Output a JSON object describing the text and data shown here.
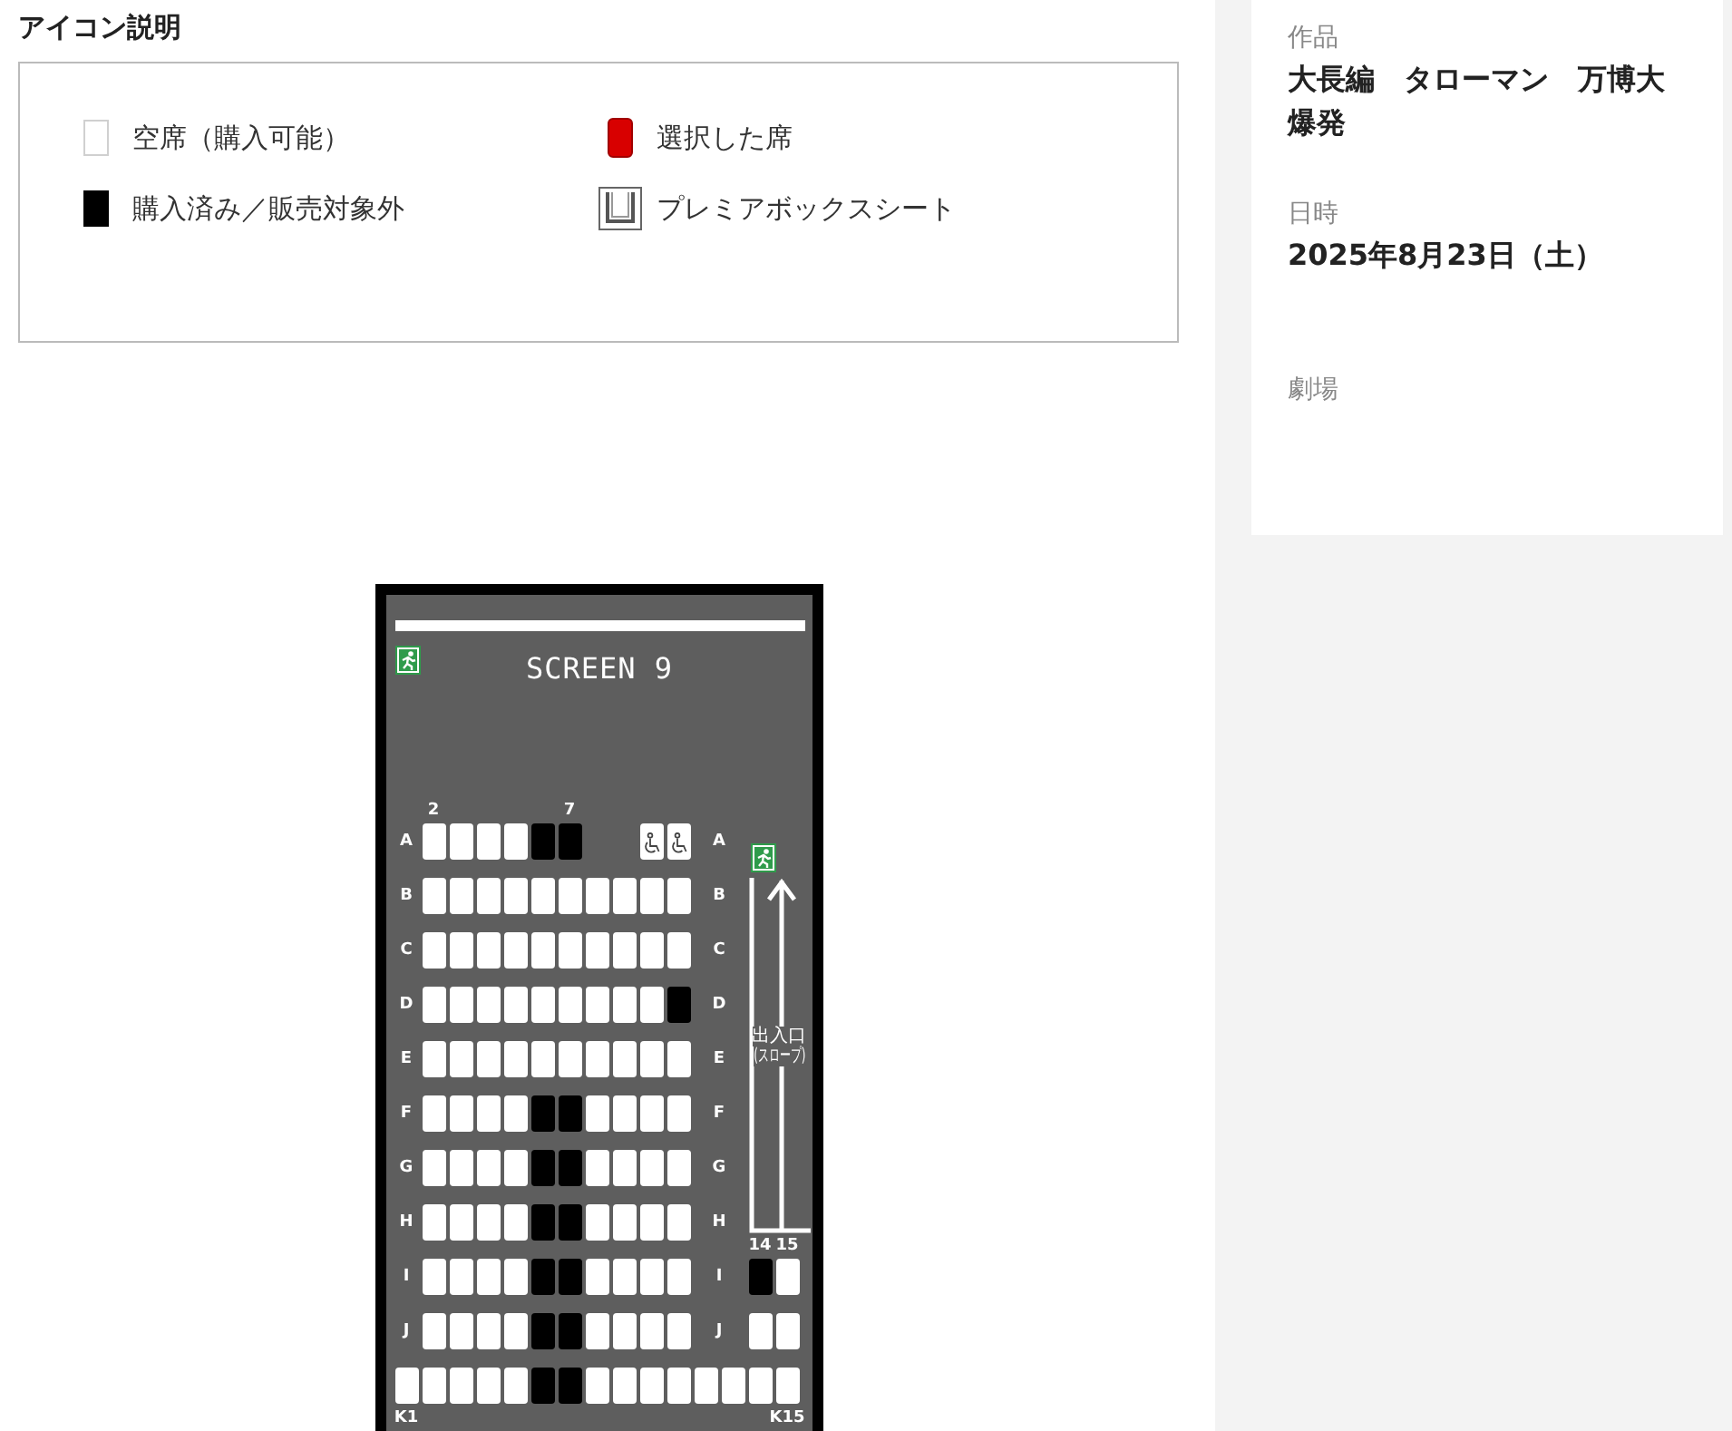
{
  "legend": {
    "title": "アイコン説明",
    "items": [
      {
        "kind": "available",
        "label": "空席（購入可能）"
      },
      {
        "kind": "selected",
        "label": "選択した席"
      },
      {
        "kind": "sold",
        "label": "購入済み／販売対象外"
      },
      {
        "kind": "premium_box",
        "label": "プレミアボックスシート"
      }
    ]
  },
  "seat_map": {
    "screen": "SCREEN 9",
    "exit_label": "出入口",
    "exit_note": "(スロープ)",
    "rows": [
      {
        "kind": "main",
        "label_left": "A",
        "label_right": "A",
        "seats": [
          {
            "kind": "seat",
            "sold": false,
            "top_label": "2"
          },
          {
            "kind": "seat",
            "sold": false
          },
          {
            "kind": "seat",
            "sold": false
          },
          {
            "kind": "seat",
            "sold": false
          },
          {
            "kind": "seat",
            "sold": true
          },
          {
            "kind": "seat",
            "sold": true,
            "top_label": "7"
          },
          {
            "kind": "gap"
          },
          {
            "kind": "gap"
          },
          {
            "kind": "wheelchair",
            "sold": false
          },
          {
            "kind": "wheelchair",
            "sold": false
          }
        ]
      },
      {
        "kind": "main",
        "label_left": "B",
        "label_right": "B",
        "seats": [
          {
            "kind": "seat",
            "sold": false
          },
          {
            "kind": "seat",
            "sold": false
          },
          {
            "kind": "seat",
            "sold": false
          },
          {
            "kind": "seat",
            "sold": false
          },
          {
            "kind": "seat",
            "sold": false
          },
          {
            "kind": "seat",
            "sold": false
          },
          {
            "kind": "seat",
            "sold": false
          },
          {
            "kind": "seat",
            "sold": false
          },
          {
            "kind": "seat",
            "sold": false
          },
          {
            "kind": "seat",
            "sold": false
          }
        ]
      },
      {
        "kind": "main",
        "label_left": "C",
        "label_right": "C",
        "seats": [
          {
            "kind": "seat",
            "sold": false
          },
          {
            "kind": "seat",
            "sold": false
          },
          {
            "kind": "seat",
            "sold": false
          },
          {
            "kind": "seat",
            "sold": false
          },
          {
            "kind": "seat",
            "sold": false
          },
          {
            "kind": "seat",
            "sold": false
          },
          {
            "kind": "seat",
            "sold": false
          },
          {
            "kind": "seat",
            "sold": false
          },
          {
            "kind": "seat",
            "sold": false
          },
          {
            "kind": "seat",
            "sold": false
          }
        ]
      },
      {
        "kind": "main",
        "label_left": "D",
        "label_right": "D",
        "seats": [
          {
            "kind": "seat",
            "sold": false
          },
          {
            "kind": "seat",
            "sold": false
          },
          {
            "kind": "seat",
            "sold": false
          },
          {
            "kind": "seat",
            "sold": false
          },
          {
            "kind": "seat",
            "sold": false
          },
          {
            "kind": "seat",
            "sold": false
          },
          {
            "kind": "seat",
            "sold": false
          },
          {
            "kind": "seat",
            "sold": false
          },
          {
            "kind": "seat",
            "sold": false
          },
          {
            "kind": "seat",
            "sold": true
          }
        ]
      },
      {
        "kind": "main",
        "label_left": "E",
        "label_right": "E",
        "seats": [
          {
            "kind": "seat",
            "sold": false
          },
          {
            "kind": "seat",
            "sold": false
          },
          {
            "kind": "seat",
            "sold": false
          },
          {
            "kind": "seat",
            "sold": false
          },
          {
            "kind": "seat",
            "sold": false
          },
          {
            "kind": "seat",
            "sold": false
          },
          {
            "kind": "seat",
            "sold": false
          },
          {
            "kind": "seat",
            "sold": false
          },
          {
            "kind": "seat",
            "sold": false
          },
          {
            "kind": "seat",
            "sold": false
          }
        ]
      },
      {
        "kind": "main",
        "label_left": "F",
        "label_right": "F",
        "seats": [
          {
            "kind": "seat",
            "sold": false
          },
          {
            "kind": "seat",
            "sold": false
          },
          {
            "kind": "seat",
            "sold": false
          },
          {
            "kind": "seat",
            "sold": false
          },
          {
            "kind": "seat",
            "sold": true
          },
          {
            "kind": "seat",
            "sold": true
          },
          {
            "kind": "seat",
            "sold": false
          },
          {
            "kind": "seat",
            "sold": false
          },
          {
            "kind": "seat",
            "sold": false
          },
          {
            "kind": "seat",
            "sold": false
          }
        ]
      },
      {
        "kind": "main",
        "label_left": "G",
        "label_right": "G",
        "seats": [
          {
            "kind": "seat",
            "sold": false
          },
          {
            "kind": "seat",
            "sold": false
          },
          {
            "kind": "seat",
            "sold": false
          },
          {
            "kind": "seat",
            "sold": false
          },
          {
            "kind": "seat",
            "sold": true
          },
          {
            "kind": "seat",
            "sold": true
          },
          {
            "kind": "seat",
            "sold": false
          },
          {
            "kind": "seat",
            "sold": false
          },
          {
            "kind": "seat",
            "sold": false
          },
          {
            "kind": "seat",
            "sold": false
          }
        ]
      },
      {
        "kind": "main",
        "label_left": "H",
        "label_right": "H",
        "seats": [
          {
            "kind": "seat",
            "sold": false
          },
          {
            "kind": "seat",
            "sold": false
          },
          {
            "kind": "seat",
            "sold": false
          },
          {
            "kind": "seat",
            "sold": false
          },
          {
            "kind": "seat",
            "sold": true
          },
          {
            "kind": "seat",
            "sold": true
          },
          {
            "kind": "seat",
            "sold": false
          },
          {
            "kind": "seat",
            "sold": false
          },
          {
            "kind": "seat",
            "sold": false
          },
          {
            "kind": "seat",
            "sold": false
          }
        ]
      },
      {
        "kind": "main",
        "label_left": "I",
        "label_right": "I",
        "seats": [
          {
            "kind": "seat",
            "sold": false
          },
          {
            "kind": "seat",
            "sold": false
          },
          {
            "kind": "seat",
            "sold": false
          },
          {
            "kind": "seat",
            "sold": false
          },
          {
            "kind": "seat",
            "sold": true
          },
          {
            "kind": "seat",
            "sold": true
          },
          {
            "kind": "seat",
            "sold": false
          },
          {
            "kind": "seat",
            "sold": false
          },
          {
            "kind": "seat",
            "sold": false
          },
          {
            "kind": "seat",
            "sold": false
          }
        ],
        "side_seats": [
          {
            "kind": "seat",
            "sold": true,
            "top_label": "14"
          },
          {
            "kind": "seat",
            "sold": false,
            "top_label": "15"
          }
        ]
      },
      {
        "kind": "main",
        "label_left": "J",
        "label_right": "J",
        "seats": [
          {
            "kind": "seat",
            "sold": false
          },
          {
            "kind": "seat",
            "sold": false
          },
          {
            "kind": "seat",
            "sold": false
          },
          {
            "kind": "seat",
            "sold": false
          },
          {
            "kind": "seat",
            "sold": true
          },
          {
            "kind": "seat",
            "sold": true
          },
          {
            "kind": "seat",
            "sold": false
          },
          {
            "kind": "seat",
            "sold": false
          },
          {
            "kind": "seat",
            "sold": false
          },
          {
            "kind": "seat",
            "sold": false
          }
        ],
        "side_seats": [
          {
            "kind": "seat",
            "sold": false
          },
          {
            "kind": "seat",
            "sold": false
          }
        ]
      },
      {
        "kind": "full",
        "seats": [
          {
            "kind": "seat",
            "sold": false,
            "bottom_label": "K1"
          },
          {
            "kind": "seat",
            "sold": false
          },
          {
            "kind": "seat",
            "sold": false
          },
          {
            "kind": "seat",
            "sold": false
          },
          {
            "kind": "seat",
            "sold": false
          },
          {
            "kind": "seat",
            "sold": true
          },
          {
            "kind": "seat",
            "sold": true
          },
          {
            "kind": "seat",
            "sold": false
          },
          {
            "kind": "seat",
            "sold": false
          },
          {
            "kind": "seat",
            "sold": false
          },
          {
            "kind": "seat",
            "sold": false
          },
          {
            "kind": "seat",
            "sold": false
          },
          {
            "kind": "seat",
            "sold": false
          },
          {
            "kind": "seat",
            "sold": false
          },
          {
            "kind": "seat",
            "sold": false,
            "bottom_label": "K15"
          }
        ]
      }
    ]
  },
  "details": [
    {
      "label": "作品",
      "value": "大長編　タローマン　万博大爆発"
    },
    {
      "label": "日時",
      "value": "2025年8月23日（土）"
    },
    {
      "label": "劇場"
    }
  ]
}
